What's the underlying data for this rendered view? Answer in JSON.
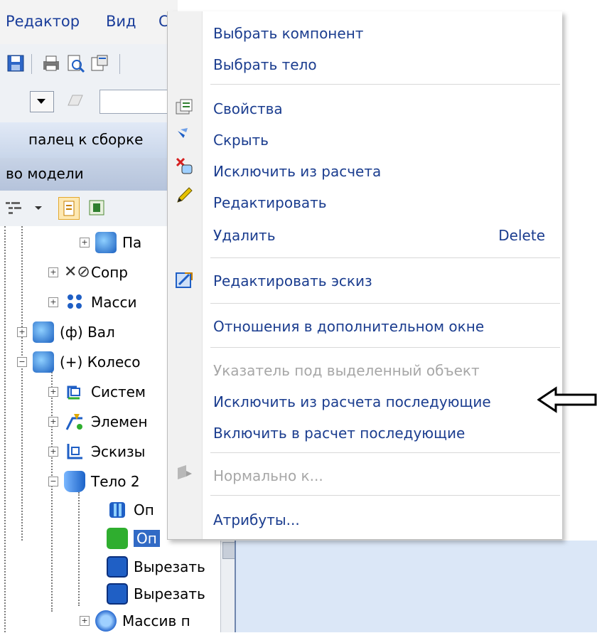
{
  "menubar": {
    "items": [
      "Редактор",
      "Вид",
      "С"
    ]
  },
  "document_tab": {
    "label": "палец к сборке"
  },
  "panel": {
    "title": "во модели"
  },
  "tree": {
    "items": [
      {
        "label": "Па",
        "icon": "part-icon"
      },
      {
        "label": "Сопр",
        "icon": "constraint-icon"
      },
      {
        "label": "Масси",
        "icon": "array-icon"
      },
      {
        "label": "(ф) Вал",
        "icon": "part-icon"
      },
      {
        "label": "(+) Колесо",
        "icon": "part-icon"
      },
      {
        "label": "Систем",
        "icon": "coordinate-system-icon"
      },
      {
        "label": "Элемен",
        "icon": "elements-icon"
      },
      {
        "label": "Эскизы",
        "icon": "sketches-icon"
      },
      {
        "label": "Тело 2",
        "icon": "body-icon"
      },
      {
        "label": "Оп",
        "icon": "operation-icon"
      },
      {
        "label": "Оп",
        "icon": "operation-selected-icon"
      },
      {
        "label": "Вырезать",
        "icon": "cut-icon"
      },
      {
        "label": "Вырезать",
        "icon": "cut-icon"
      },
      {
        "label": "Массив п",
        "icon": "array-icon"
      }
    ]
  },
  "context_menu": {
    "items": [
      {
        "label": "Выбрать компонент",
        "enabled": true,
        "icon": ""
      },
      {
        "label": "Выбрать тело",
        "enabled": true,
        "icon": ""
      },
      {
        "label": "Свойства",
        "enabled": true,
        "icon": "properties-icon"
      },
      {
        "label": "Скрыть",
        "enabled": true,
        "icon": "hide-icon"
      },
      {
        "label": "Исключить из расчета",
        "enabled": true,
        "icon": "exclude-icon"
      },
      {
        "label": "Редактировать",
        "enabled": true,
        "icon": "pencil-icon"
      },
      {
        "label": "Удалить",
        "enabled": true,
        "icon": "",
        "shortcut": "Delete"
      },
      {
        "label": "Редактировать эскиз",
        "enabled": true,
        "icon": "edit-sketch-icon"
      },
      {
        "label": "Отношения в дополнительном окне",
        "enabled": true,
        "icon": ""
      },
      {
        "label": "Указатель под выделенный объект",
        "enabled": false,
        "icon": ""
      },
      {
        "label": "Исключить из расчета последующие",
        "enabled": true,
        "icon": ""
      },
      {
        "label": "Включить в расчет последующие",
        "enabled": true,
        "icon": ""
      },
      {
        "label": "Нормально к...",
        "enabled": false,
        "icon": "normal-to-icon"
      },
      {
        "label": "Атрибуты...",
        "enabled": true,
        "icon": ""
      }
    ]
  },
  "annotation": {
    "icon": "outline-arrow-left-icon",
    "points_to": "Исключить из расчета последующие"
  },
  "colors": {
    "menu_text": "#1b3d8f",
    "disabled_text": "#a7a7a7",
    "selection": "#316ac5",
    "panel_header": "#c7d3e6"
  }
}
